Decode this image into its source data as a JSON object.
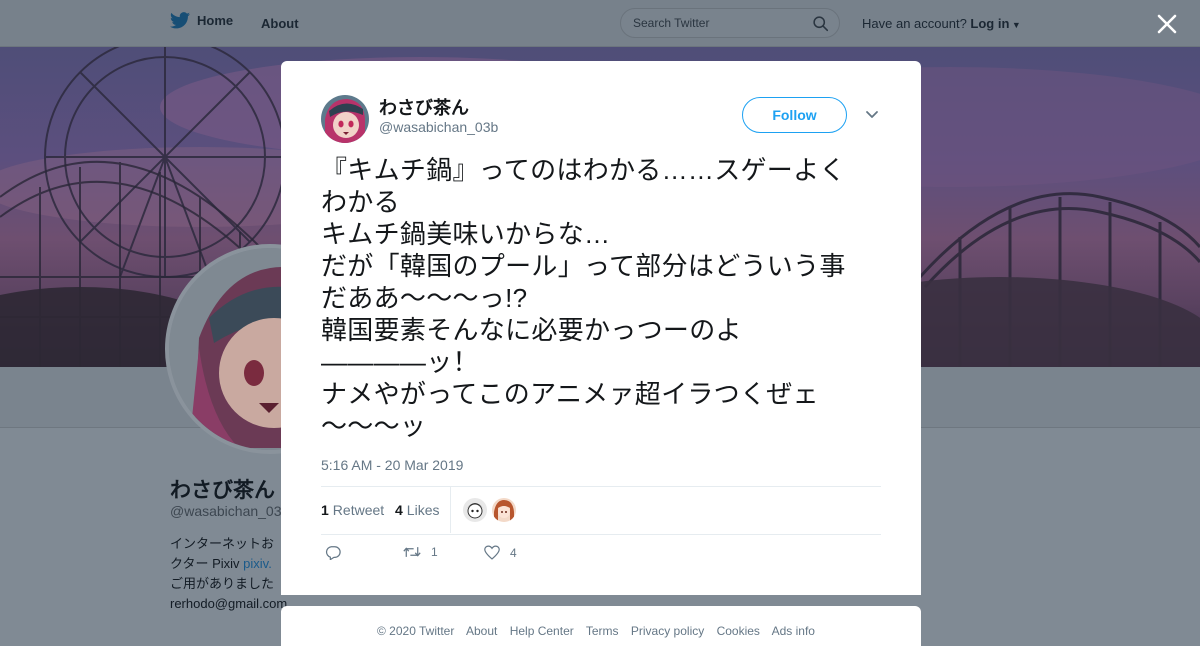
{
  "nav": {
    "home_label": "Home",
    "about_label": "About",
    "search_placeholder": "Search Twitter",
    "account_prompt": "Have an account?",
    "login_label": "Log in"
  },
  "profile": {
    "name": "わさび茶ん",
    "handle": "@wasabichan_03",
    "bio_lines": [
      "インターネットお",
      "クター Pixiv ",
      "ご用がありました",
      "rerhodo@gmail.com"
    ],
    "bio_link": "pixiv."
  },
  "tweet": {
    "author_name": "わさび茶ん",
    "author_handle": "@wasabichan_03b",
    "follow_label": "Follow",
    "text": "『キムチ鍋』ってのはわかる……スゲーよく\nわかる\nキムチ鍋美味いからな…\nだが「韓国のプール」って部分はどういう事\nだああ～～～っ!?\n韓国要素そんなに必要かっつーのよ\n――――ッ！\nナメやがってこのアニメァ超イラつくぜェ\n～～～ッ",
    "timestamp": "5:16 AM - 20 Mar 2019",
    "retweets_count": "1",
    "retweets_label": "Retweet",
    "likes_count": "4",
    "likes_label": "Likes",
    "action_retweet_count": "1",
    "action_like_count": "4"
  },
  "footer": {
    "links": [
      "© 2020 Twitter",
      "About",
      "Help Center",
      "Terms",
      "Privacy policy",
      "Cookies",
      "Ads info"
    ]
  },
  "colors": {
    "accent": "#1da1f2",
    "overlay": "#808a94"
  },
  "icons": [
    "twitter-bird-icon",
    "search-icon",
    "close-icon",
    "chevron-down-icon",
    "reply-icon",
    "retweet-icon",
    "heart-icon"
  ]
}
